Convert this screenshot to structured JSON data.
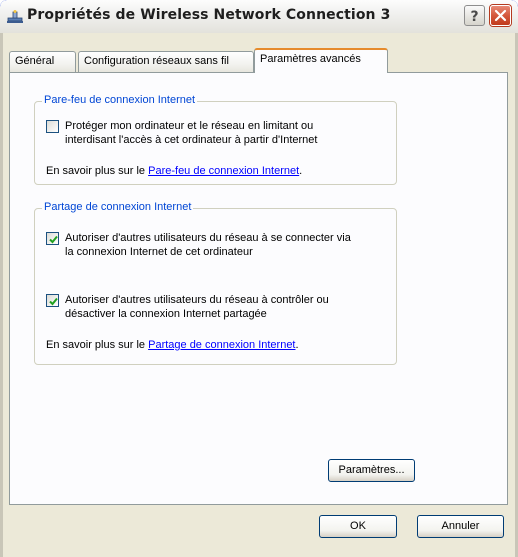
{
  "window": {
    "title": "Propriétés de Wireless Network Connection 3"
  },
  "tabs": [
    {
      "label": "Général"
    },
    {
      "label": "Configuration réseaux sans fil"
    },
    {
      "label": "Paramètres avancés",
      "active": true
    }
  ],
  "firewall": {
    "legend": "Pare-feu de connexion Internet",
    "checkbox": {
      "line1": "Protéger mon ordinateur et le réseau en limitant ou",
      "line2": "interdisant l'accès à cet ordinateur à partir d'Internet",
      "checked": false
    },
    "more_prefix": "En savoir plus sur le ",
    "more_link": "Pare-feu de connexion Internet",
    "more_suffix": "."
  },
  "sharing": {
    "legend": "Partage de connexion Internet",
    "checkbox1": {
      "line1": "Autoriser d'autres utilisateurs du réseau à se connecter via",
      "line2": "la connexion Internet de cet ordinateur",
      "checked": true
    },
    "checkbox2": {
      "line1": "Autoriser d'autres utilisateurs du réseau à contrôler ou",
      "line2": "désactiver la connexion Internet partagée",
      "checked": true
    },
    "more_prefix": "En savoir plus sur le ",
    "more_link": "Partage de connexion Internet",
    "more_suffix": "."
  },
  "buttons": {
    "settings": "Paramètres...",
    "ok": "OK",
    "cancel": "Annuler"
  },
  "colors": {
    "title_bar": "#ebe9e3",
    "dialog_bg": "#ece9d8",
    "active_tab_accent": "#e68b2c",
    "group_legend": "#0046d5",
    "link": "#0000ff",
    "close_button": "#d4583c"
  }
}
